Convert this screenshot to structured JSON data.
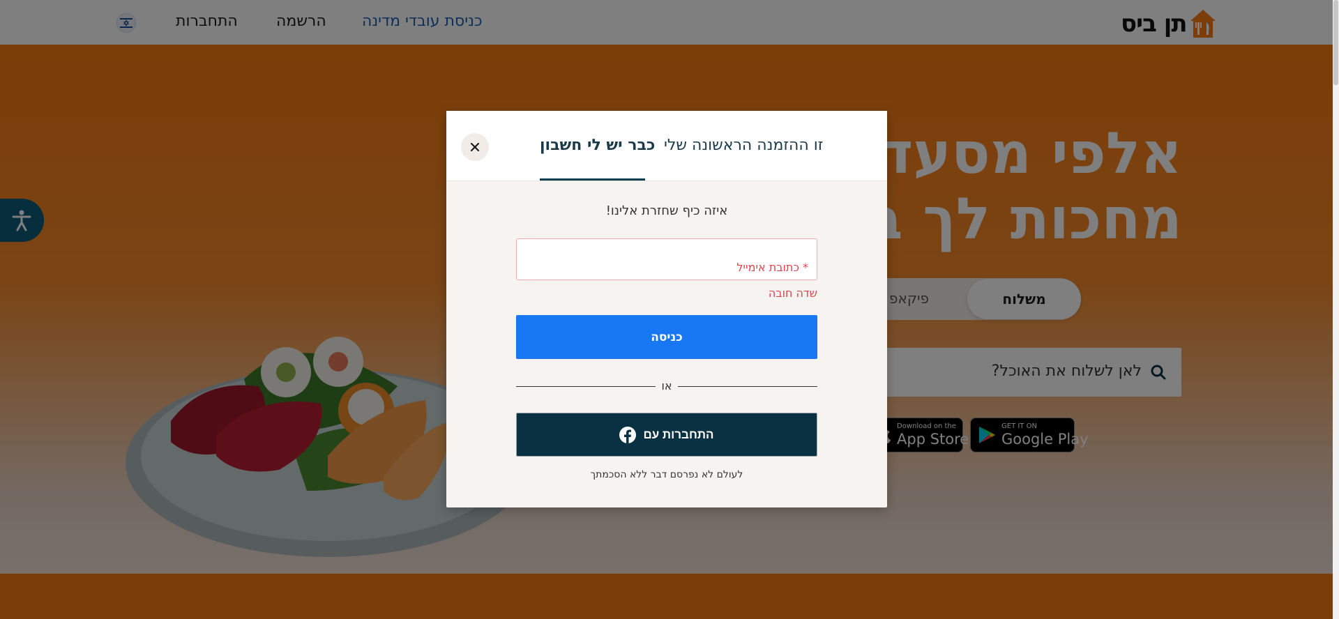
{
  "header": {
    "brand": "תן ביס",
    "nav": {
      "gov_login": "כניסת עובדי מדינה",
      "register": "הרשמה",
      "login": "התחברות"
    }
  },
  "hero": {
    "title_line1": "אלפי מסעד",
    "title_line2": "מחכות לך ב",
    "delivery_mode": {
      "delivery": "משלוח",
      "pickup": "פיקאפ",
      "selected": "משלוח"
    },
    "search_prompt": "לאן לשלוח את האוכל?",
    "app_store": {
      "small": "Download on the",
      "big": "App Store"
    },
    "google_play": {
      "small": "GET IT ON",
      "big": "Google Play"
    }
  },
  "modal": {
    "tabs": {
      "first_order": "זו ההזמנה הראשונה שלי",
      "have_account": "כבר יש לי חשבון",
      "active": "כבר יש לי חשבון"
    },
    "close_symbol": "✕",
    "welcome": "איזה כיף שחזרת אלינו!",
    "email_label": "* כתובת אימייל",
    "email_value": "",
    "field_error": "שדה חובה",
    "submit_label": "כניסה",
    "divider_text": "או",
    "facebook_label": "התחברות עם",
    "privacy_note": "לעולם לא נפרסם דבר ללא הסכמתך"
  },
  "colors": {
    "brand_orange": "#f77b12",
    "primary_blue": "#1877f2",
    "dark_teal": "#0a3142",
    "error_red": "#e0454f",
    "gov_link_blue": "#1a5fb4",
    "a11y_teal": "#0d5c78"
  },
  "icons": {
    "brand": "house-fork-knife-icon",
    "flag": "israel-flag-icon",
    "accessibility": "accessibility-icon",
    "search": "search-icon",
    "close": "close-icon",
    "facebook": "facebook-icon",
    "apple": "apple-icon",
    "google_play": "google-play-icon"
  }
}
